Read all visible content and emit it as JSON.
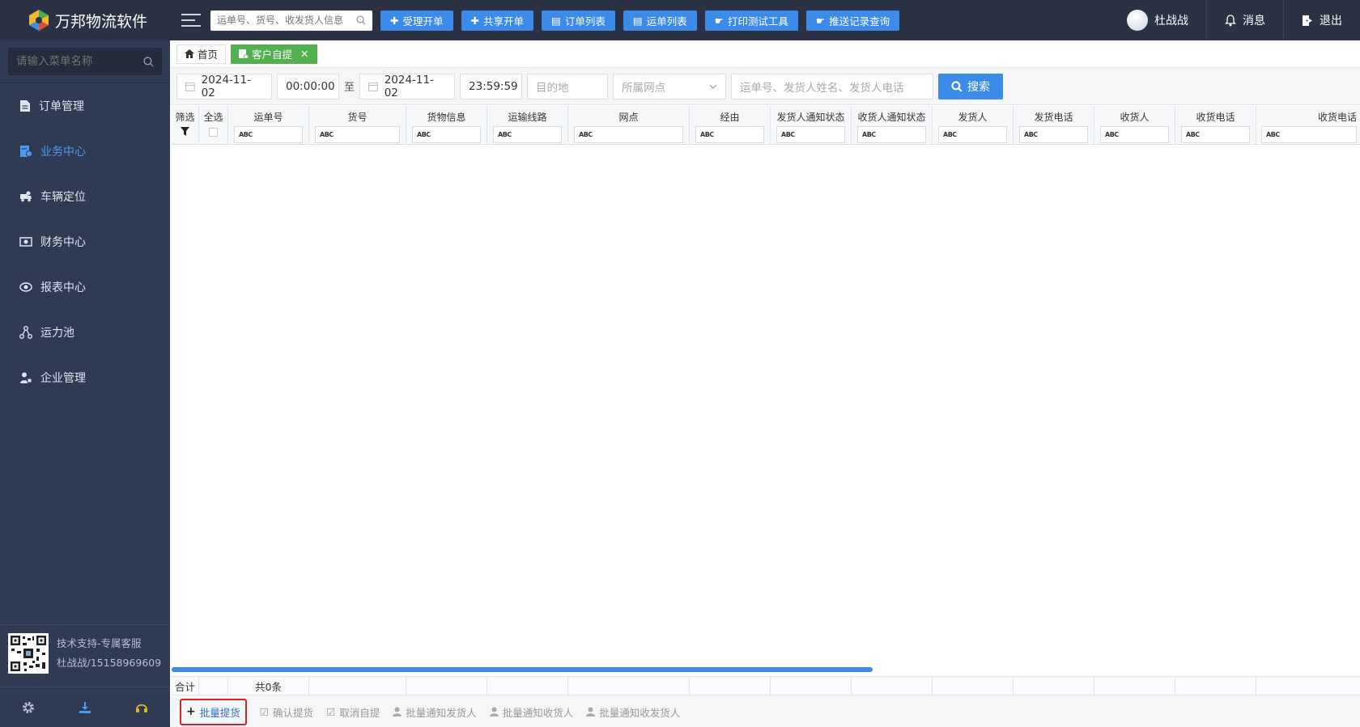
{
  "app": {
    "logo_text": "万邦物流软件",
    "top_search_placeholder": "运单号、货号、收发货人信息",
    "top_buttons": [
      {
        "label": "受理开单",
        "icon": "plus-icon"
      },
      {
        "label": "共享开单",
        "icon": "plus-icon"
      },
      {
        "label": "订单列表",
        "icon": "list-icon"
      },
      {
        "label": "运单列表",
        "icon": "list-icon"
      },
      {
        "label": "打印测试工具",
        "icon": "hand-icon"
      },
      {
        "label": "推送记录查询",
        "icon": "hand-icon"
      }
    ],
    "user_name": "杜战战",
    "messages_label": "消息",
    "logout_label": "退出"
  },
  "sidebar": {
    "search_placeholder": "请输入菜单名称",
    "items": [
      {
        "label": "订单管理",
        "icon": "document-icon",
        "active": false
      },
      {
        "label": "业务中心",
        "icon": "business-icon",
        "active": true
      },
      {
        "label": "车辆定位",
        "icon": "truck-icon",
        "active": false
      },
      {
        "label": "财务中心",
        "icon": "money-icon",
        "active": false
      },
      {
        "label": "报表中心",
        "icon": "eye-icon",
        "active": false
      },
      {
        "label": "运力池",
        "icon": "network-icon",
        "active": false
      },
      {
        "label": "企业管理",
        "icon": "enterprise-icon",
        "active": false
      }
    ],
    "support_title": "技术支持-专属客服",
    "support_contact": "杜战战/15158969609"
  },
  "tabs": [
    {
      "label": "首页",
      "icon": "home-icon",
      "active": false
    },
    {
      "label": "客户自提",
      "icon": "pickup-icon",
      "active": true
    }
  ],
  "filters": {
    "start_date": "2024-11-02",
    "start_time": "00:00:00",
    "to_label": "至",
    "end_date": "2024-11-02",
    "end_time": "23:59:59",
    "destination_placeholder": "目的地",
    "branch_placeholder": "所属网点",
    "keyword_placeholder": "运单号、发货人姓名、发货人电话",
    "search_label": "搜索"
  },
  "grid": {
    "filter_label": "筛选",
    "select_all_label": "全选",
    "columns": [
      "运单号",
      "货号",
      "货物信息",
      "运输线路",
      "网点",
      "经由",
      "发货人通知状态",
      "收货人通知状态",
      "发货人",
      "发货电话",
      "收货人",
      "收货电话",
      "收货电话"
    ],
    "filter_tag": "ABC",
    "summary_label": "合计",
    "summary_count": "共0条"
  },
  "actions": [
    {
      "label": "批量提货",
      "icon": "plus-icon",
      "primary": true
    },
    {
      "label": "确认提货",
      "icon": "edit-icon",
      "primary": false
    },
    {
      "label": "取消自提",
      "icon": "edit-icon",
      "primary": false
    },
    {
      "label": "批量通知发货人",
      "icon": "user-icon",
      "primary": false
    },
    {
      "label": "批量通知收货人",
      "icon": "user-icon",
      "primary": false
    },
    {
      "label": "批量通知收发货人",
      "icon": "user-icon",
      "primary": false
    }
  ],
  "colors": {
    "topbar": "#2b3245",
    "sidebar": "#2f3b52",
    "accent": "#3d8be8",
    "active_tab": "#52b04e",
    "highlight": "#e02020"
  }
}
